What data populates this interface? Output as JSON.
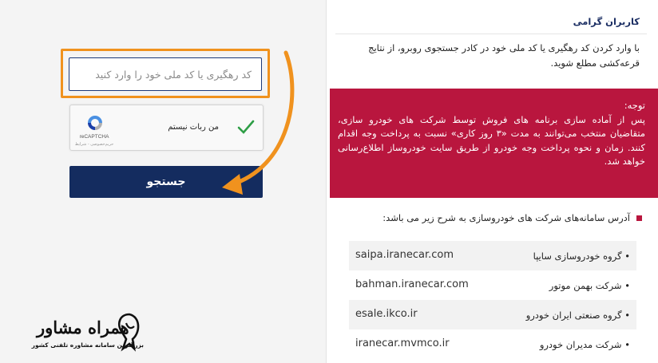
{
  "search": {
    "placeholder": "کد رهگیری یا کد ملی خود را وارد کنید",
    "button_label": "جستجو"
  },
  "recaptcha": {
    "label": "من ربات نیستم",
    "brand": "reCAPTCHA",
    "terms": "حریم‌خصوصی - شرایط"
  },
  "greeting": {
    "title": "کاربران گرامی",
    "text": "با وارد کردن کد رهگیری یا کد ملی خود در کادر جستجوی روبرو، از نتایج قرعه‌کشی مطلع شوید."
  },
  "notice": {
    "title": "توجه:",
    "body": "پس از آماده سازی برنامه های فروش توسط شرکت های خودرو سازی، متقاضیان منتخب می‌توانند به مدت «۳ روز کاری» نسبت به پرداخت وجه اقدام کنند. زمان و نحوه پرداخت وجه خودرو از طریق سایت خودروساز اطلاع‌رسانی خواهد شد."
  },
  "links": {
    "title": "آدرس سامانه‌های شرکت های خودروسازی به شرح زیر می باشد:",
    "items": [
      {
        "name": "• گروه خودروسازی سایپا",
        "url": "saipa.iranecar.com"
      },
      {
        "name": "• شرکت بهمن موتور",
        "url": "bahman.iranecar.com"
      },
      {
        "name": "• گروه صنعتی ایران خودرو",
        "url": "esale.ikco.ir"
      },
      {
        "name": "• شرکت مدیران خودرو",
        "url": "iranecar.mvmco.ir"
      }
    ]
  },
  "watermark": {
    "title": "همراه مشاور",
    "subtitle": "بزرگترین سامانه مشاوره تلفنی کشور"
  },
  "colors": {
    "navy": "#142c5f",
    "crimson": "#b9163e",
    "orange": "#f0921e"
  }
}
